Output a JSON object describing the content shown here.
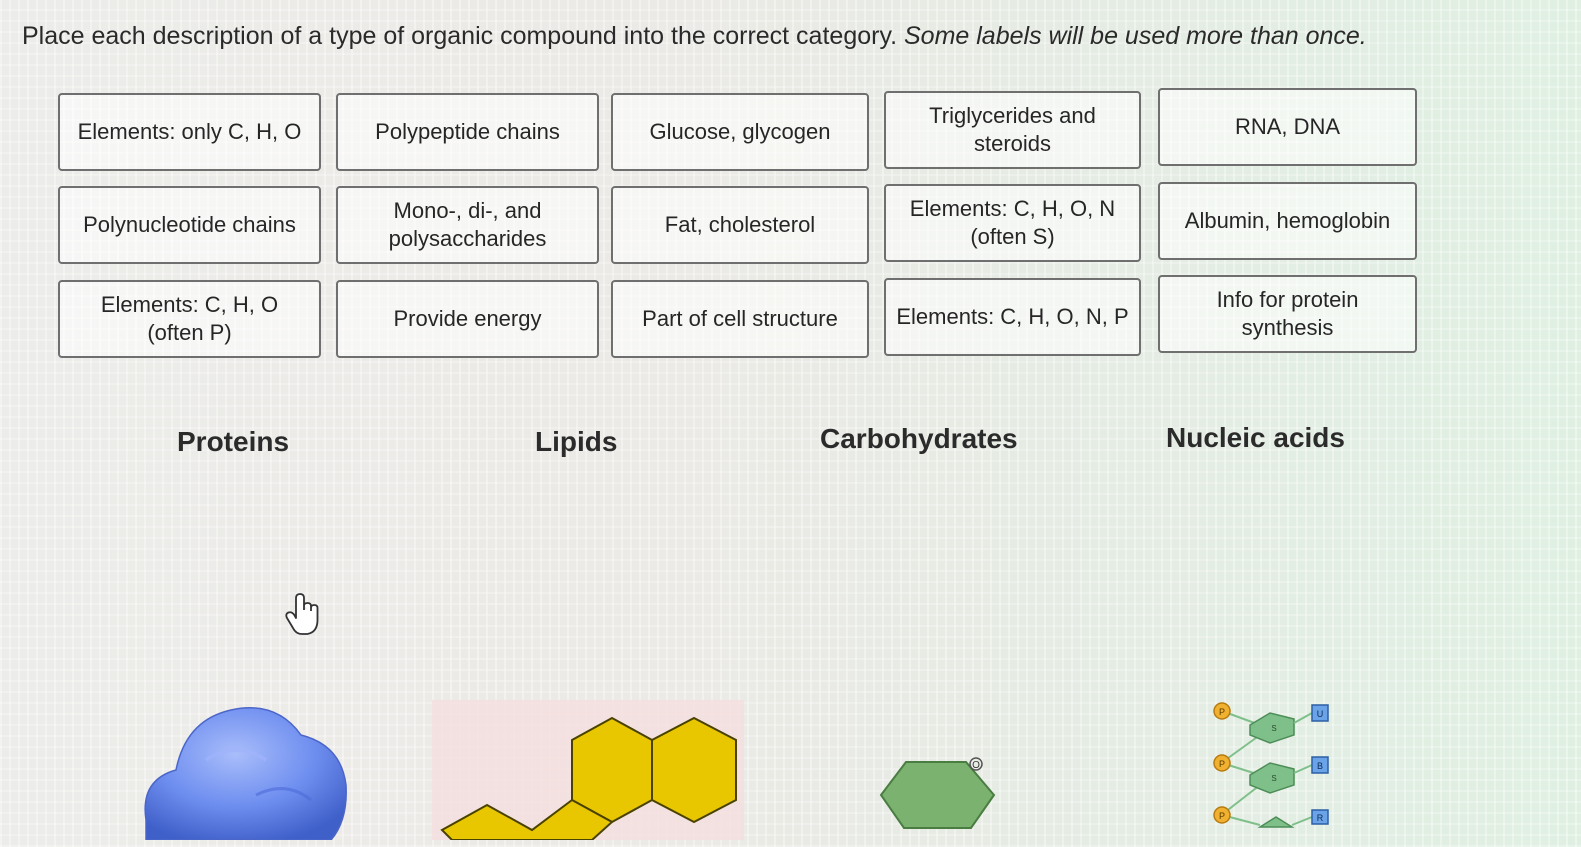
{
  "instructions": {
    "main": "Place each description of a type of organic compound into the correct category.",
    "note": "Some labels will be used more than once."
  },
  "labels": {
    "elements_only_chO": "Elements: only C, H, O",
    "polypeptide_chains": "Polypeptide chains",
    "glucose_glycogen": "Glucose, glycogen",
    "triglycerides_steroids": "Triglycerides and steroids",
    "rna_dna": "RNA, DNA",
    "polynucleotide_chains": "Polynucleotide chains",
    "mono_di_poly": "Mono-, di-, and polysaccharides",
    "fat_cholesterol": "Fat, cholesterol",
    "elements_chons": "Elements: C, H, O, N (often S)",
    "albumin_hemoglobin": "Albumin, hemoglobin",
    "elements_cho_p": "Elements: C, H, O (often P)",
    "provide_energy": "Provide energy",
    "cell_structure": "Part of cell structure",
    "elements_chonp": "Elements: C, H, O, N, P",
    "protein_synthesis": "Info for protein synthesis"
  },
  "categories": {
    "proteins": "Proteins",
    "lipids": "Lipids",
    "carbohydrates": "Carbohydrates",
    "nucleic_acids": "Nucleic acids"
  },
  "illustrations": {
    "carbohydrate_ring_atom": "O",
    "nucleotide_phosphate": "P",
    "nucleotide_sugar": "S",
    "nucleotide_base_1": "U",
    "nucleotide_base_2": "B",
    "nucleotide_base_3": "R"
  },
  "colors": {
    "protein_blob": "#6f8ff0",
    "lipid_rings": "#e8c600",
    "lipid_bg": "#f4dede",
    "carb_ring": "#7bb26f",
    "phosphate": "#f0b030",
    "sugar": "#7fc08a",
    "base": "#6aa3e8"
  }
}
